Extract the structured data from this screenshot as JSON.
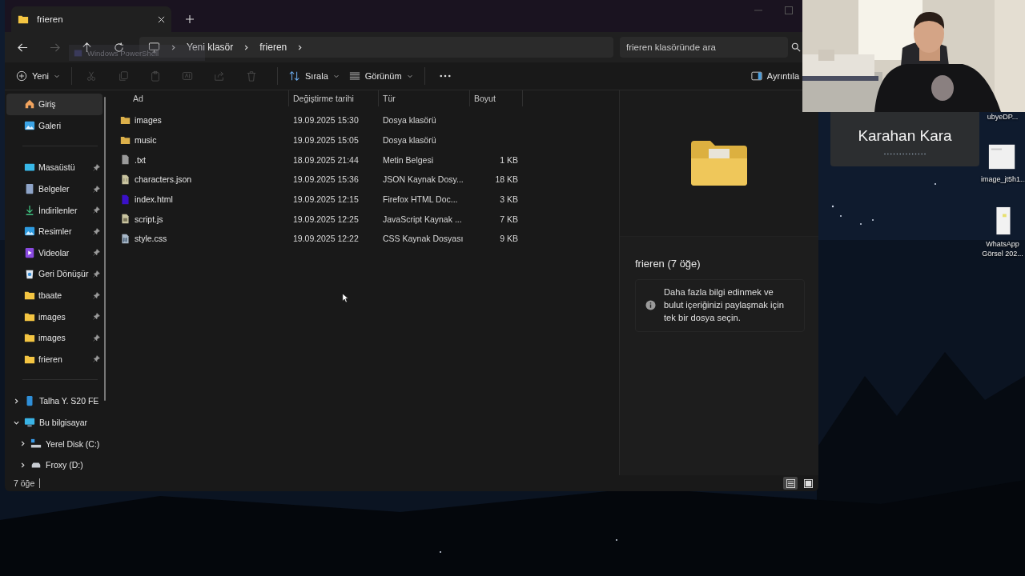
{
  "explorer": {
    "tab": {
      "title": "frieren",
      "selected": true
    },
    "ghost_window": {
      "title": "Windows PowerShell"
    },
    "navigation": {
      "back_disabled": false,
      "forward_disabled": true
    },
    "breadcrumb": [
      "Yeni klasör",
      "frieren"
    ],
    "search": {
      "placeholder": "frieren klasöründe ara"
    },
    "toolbar": {
      "new": "Yeni",
      "sort": "Sırala",
      "view": "Görünüm",
      "details": "Ayrıntıla",
      "actions": [
        {
          "kind": "cut",
          "disabled": true
        },
        {
          "kind": "copy",
          "disabled": true
        },
        {
          "kind": "paste",
          "disabled": true
        },
        {
          "kind": "rename",
          "disabled": true
        },
        {
          "kind": "share",
          "disabled": true
        },
        {
          "kind": "delete",
          "disabled": true
        }
      ]
    },
    "sidebar": {
      "items": [
        {
          "label": "Giriş",
          "kind": "home",
          "selected": true,
          "pinned": false
        },
        {
          "label": "Galeri",
          "kind": "gallery",
          "selected": false,
          "pinned": false
        }
      ],
      "pinned_items": [
        {
          "label": "Masaüstü",
          "kind": "desktop",
          "selected": false,
          "pinned": true
        },
        {
          "label": "Belgeler",
          "kind": "documents",
          "selected": false,
          "pinned": true
        },
        {
          "label": "İndirilenler",
          "kind": "downloads",
          "selected": false,
          "pinned": true
        },
        {
          "label": "Resimler",
          "kind": "pictures",
          "selected": false,
          "pinned": true
        },
        {
          "label": "Videolar",
          "kind": "videos",
          "selected": false,
          "pinned": true
        },
        {
          "label": "Geri Dönüşür",
          "kind": "recycle",
          "selected": false,
          "pinned": true
        },
        {
          "label": "tbaate",
          "kind": "folder",
          "selected": false,
          "pinned": true
        },
        {
          "label": "images",
          "kind": "folder",
          "selected": false,
          "pinned": true
        },
        {
          "label": "images",
          "kind": "folder",
          "selected": false,
          "pinned": true
        },
        {
          "label": "frieren",
          "kind": "folder",
          "selected": false,
          "pinned": true
        }
      ],
      "tree": [
        {
          "label": "Talha Y. S20 FE",
          "kind": "phone",
          "expanded": false,
          "selected": false
        },
        {
          "label": "Bu bilgisayar",
          "kind": "computer",
          "expanded": true,
          "selected": false,
          "children": [
            {
              "label": "Yerel Disk (C:)",
              "kind": "system-drive",
              "expanded": false,
              "selected": false
            },
            {
              "label": "Froxy (D:)",
              "kind": "drive",
              "expanded": false,
              "selected": false
            }
          ]
        }
      ]
    },
    "table": {
      "columns": [
        "Ad",
        "Değiştirme tarihi",
        "Tür",
        "Boyut"
      ],
      "rows": [
        {
          "kind": "folder",
          "name": "images",
          "modified": "19.09.2025 15:30",
          "type": "Dosya klasörü",
          "selected": false
        },
        {
          "kind": "folder",
          "name": "music",
          "modified": "19.09.2025 15:05",
          "type": "Dosya klasörü",
          "selected": false
        },
        {
          "kind": "text",
          "name": ".txt",
          "modified": "18.09.2025 21:44",
          "type": "Metin Belgesi",
          "size": "1 KB",
          "selected": false
        },
        {
          "kind": "json",
          "name": "characters.json",
          "modified": "19.09.2025 15:36",
          "type": "JSON Kaynak Dosy...",
          "size": "18 KB",
          "selected": false
        },
        {
          "kind": "html",
          "name": "index.html",
          "modified": "19.09.2025 12:15",
          "type": "Firefox HTML Doc...",
          "size": "3 KB",
          "selected": false
        },
        {
          "kind": "js",
          "name": "script.js",
          "modified": "19.09.2025 12:25",
          "type": "JavaScript Kaynak ...",
          "size": "7 KB",
          "selected": false
        },
        {
          "kind": "css",
          "name": "style.css",
          "modified": "19.09.2025 12:22",
          "type": "CSS Kaynak Dosyası",
          "size": "9 KB",
          "selected": false
        }
      ]
    },
    "details_pane": {
      "title": "frieren (7 öğe)",
      "info": "Daha fazla bilgi edinmek ve bulut içeriğinizi paylaşmak için tek bir dosya seçin."
    },
    "status_bar": {
      "count": "7 öğe",
      "views": [
        {
          "kind": "details",
          "selected": true
        },
        {
          "kind": "tiles",
          "selected": false
        }
      ]
    }
  },
  "video_call": {
    "kind": "picture",
    "name": "Karahan Kara"
  },
  "desktop_icons": [
    {
      "label": "ubyeDP..."
    },
    {
      "kind": "document",
      "label": "image_jt5h1..."
    },
    {
      "kind": "phone-image",
      "label": "WhatsApp Görsel 202..."
    }
  ]
}
